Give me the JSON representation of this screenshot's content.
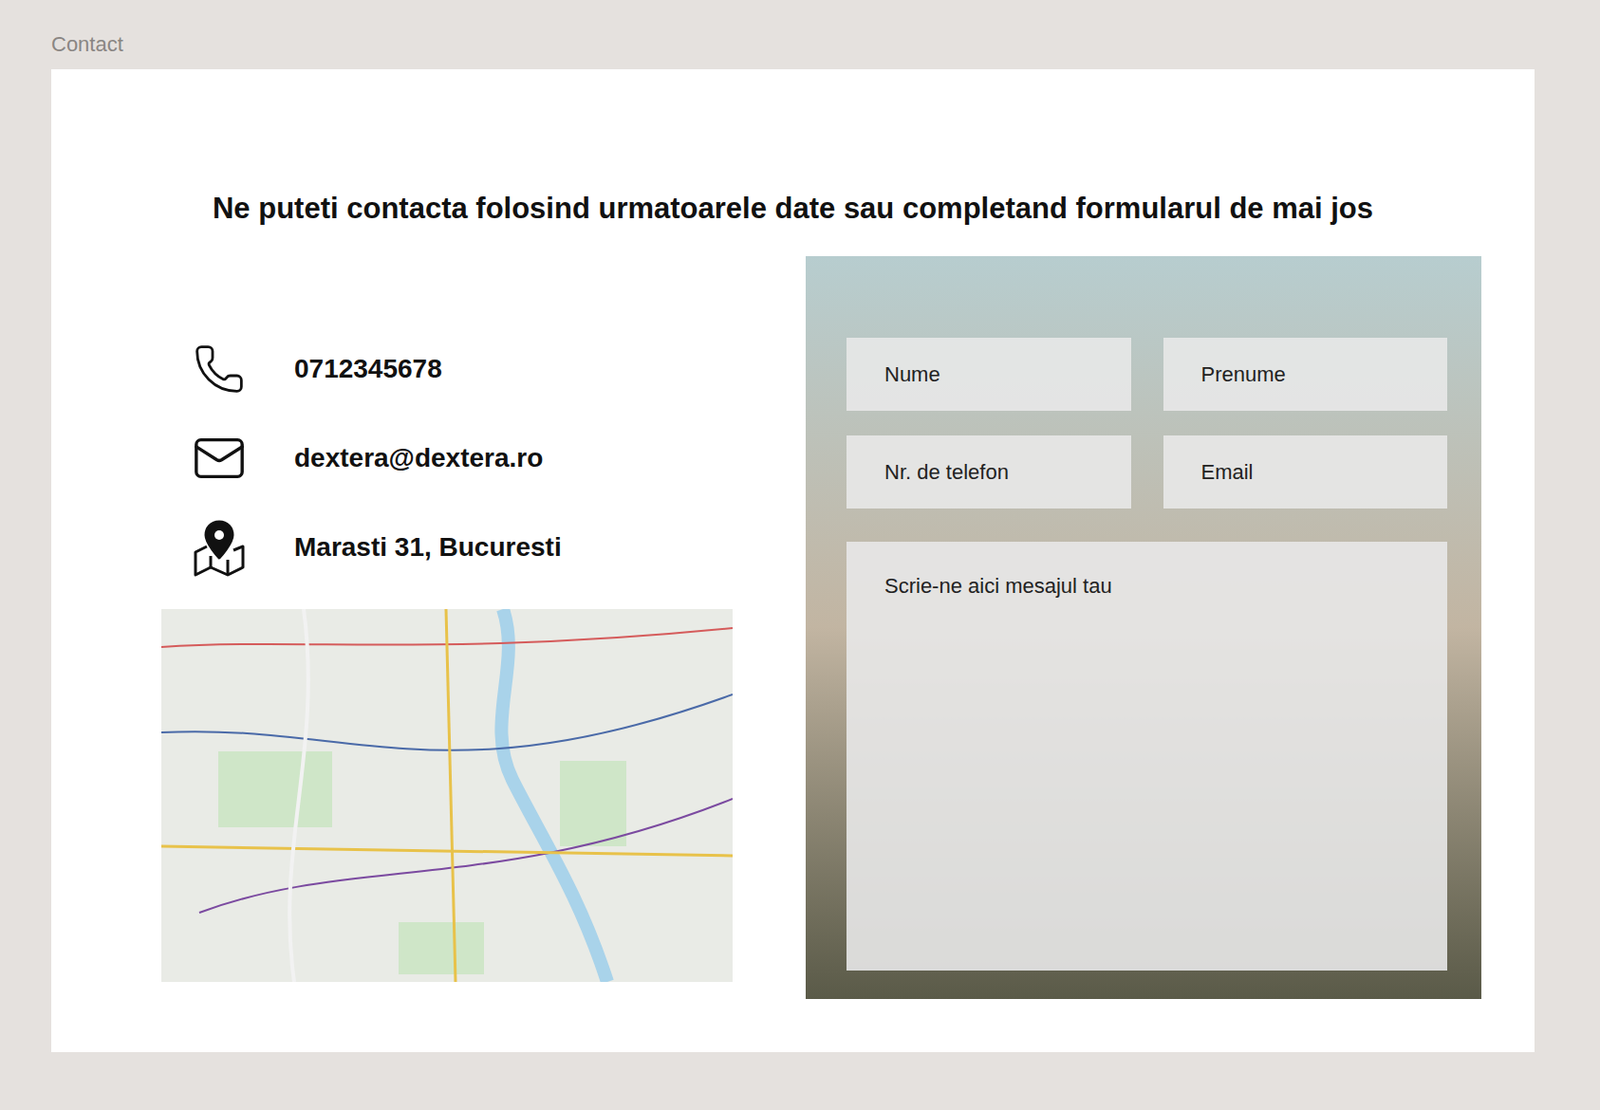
{
  "page": {
    "title": "Contact"
  },
  "heading": "Ne puteti contacta folosind urmatoarele date sau completand formularul de mai jos",
  "contacts": [
    {
      "kind": "phone",
      "text": "0712345678"
    },
    {
      "kind": "email",
      "text": "dextera@dextera.ro"
    },
    {
      "kind": "address",
      "text": "Marasti 31, Bucuresti"
    }
  ],
  "form": {
    "fields": [
      {
        "placeholder": "Nume"
      },
      {
        "placeholder": "Prenume"
      },
      {
        "placeholder": "Nr. de telefon"
      },
      {
        "placeholder": "Email"
      }
    ],
    "message": {
      "placeholder": "Scrie-ne aici mesajul tau"
    }
  }
}
